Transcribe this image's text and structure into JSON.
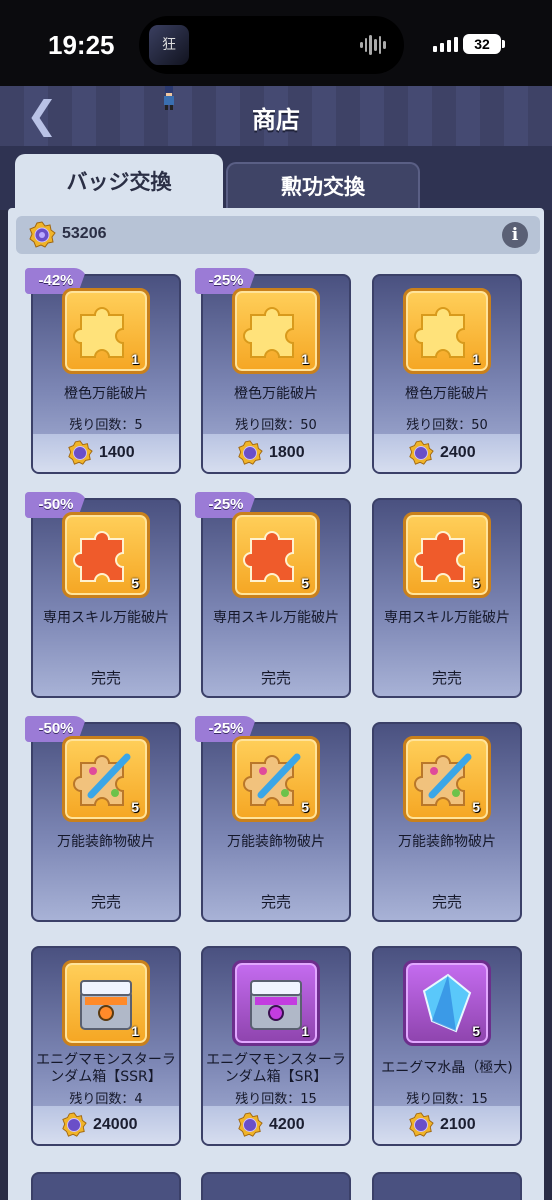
{
  "status": {
    "time": "19:25",
    "battery": "32",
    "app_icon_text": "狂"
  },
  "header": {
    "back": "❮",
    "title": "商店"
  },
  "tabs": [
    {
      "label": "バッジ交換",
      "active": true
    },
    {
      "label": "勲功交換",
      "active": false
    }
  ],
  "currency": {
    "amount": "53206",
    "icon": "badge-coin-icon",
    "info": "i"
  },
  "cards": [
    {
      "discount": "-42%",
      "name": "橙色万能破片",
      "qty": "1",
      "remain": "残り回数：5",
      "price": "1400",
      "icon": "puzzle-gold-icon"
    },
    {
      "discount": "-25%",
      "name": "橙色万能破片",
      "qty": "1",
      "remain": "残り回数：50",
      "price": "1800",
      "icon": "puzzle-gold-icon"
    },
    {
      "discount": "",
      "name": "橙色万能破片",
      "qty": "1",
      "remain": "残り回数：50",
      "price": "2400",
      "icon": "puzzle-gold-icon"
    },
    {
      "discount": "-50%",
      "name": "専用スキル万能破片",
      "qty": "5",
      "status": "完売",
      "icon": "puzzle-red-icon"
    },
    {
      "discount": "-25%",
      "name": "専用スキル万能破片",
      "qty": "5",
      "status": "完売",
      "icon": "puzzle-red-icon"
    },
    {
      "discount": "",
      "name": "専用スキル万能破片",
      "qty": "5",
      "status": "完売",
      "icon": "puzzle-red-icon"
    },
    {
      "discount": "-50%",
      "name": "万能装飾物破片",
      "qty": "5",
      "status": "完売",
      "icon": "puzzle-brush-icon"
    },
    {
      "discount": "-25%",
      "name": "万能装飾物破片",
      "qty": "5",
      "status": "完売",
      "icon": "puzzle-brush-icon"
    },
    {
      "discount": "",
      "name": "万能装飾物破片",
      "qty": "5",
      "status": "完売",
      "icon": "puzzle-brush-icon"
    },
    {
      "discount": "",
      "name": "エニグマモンスターランダム箱【SSR】",
      "qty": "1",
      "remain": "残り回数：4",
      "price": "24000",
      "icon": "chest-orange-icon"
    },
    {
      "discount": "",
      "name": "エニグマモンスターランダム箱【SR】",
      "qty": "1",
      "remain": "残り回数：15",
      "price": "4200",
      "icon": "chest-purple-icon"
    },
    {
      "discount": "",
      "name": "エニグマ水晶（極大)",
      "qty": "5",
      "remain": "残り回数：15",
      "price": "2100",
      "icon": "crystal-icon"
    }
  ],
  "colors": {
    "badge": "#9b7bd6",
    "panel": "#d9e2ee",
    "card_top": "#4a5180",
    "coin": "#f0b429"
  }
}
